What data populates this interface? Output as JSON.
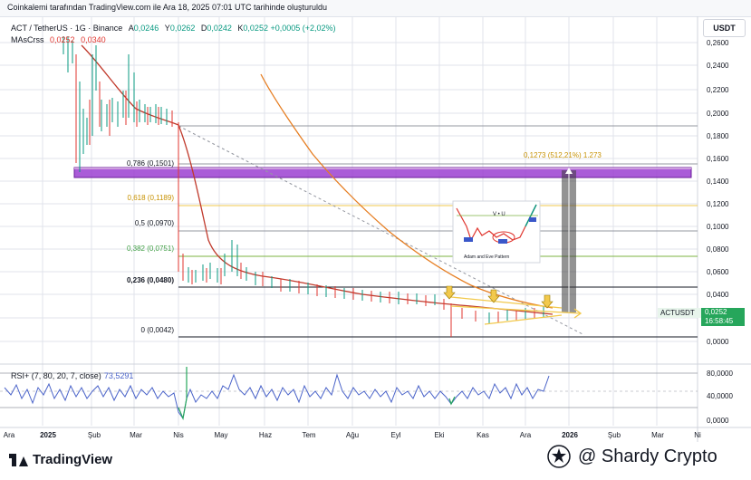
{
  "caption": "Coinkalemi tarafından TradingView.com ile Ara 18, 2025 07:01 UTC tarihinde oluşturuldu",
  "legend": {
    "symbol": "ACT / TetherUS · 1G · Binance",
    "ohlc": [
      {
        "k": "A",
        "v": "0,0246"
      },
      {
        "k": "Y",
        "v": "0,0262"
      },
      {
        "k": "D",
        "v": "0,0242"
      },
      {
        "k": "K",
        "v": "0,0252"
      }
    ],
    "change": "+0,0005 (+2,02%)",
    "mas_label": "MAsCrss",
    "mas_val1": "0,0252",
    "mas_val2": "0,0340"
  },
  "currency_button": "USDT",
  "fib_labels": {
    "f786": "0,786 (0,1501)",
    "f618": "0,618 (0,1189)",
    "f5": "0,5 (0,0970)",
    "f382": "0,382 (0,0751)",
    "f236": "0,236 (0,0480)",
    "f0": "0 (0,0042)"
  },
  "target_label": "0,1273 (512,21%) 1.273",
  "pattern_thumbnail": {
    "center_text": "V • U",
    "caption": "Adam and Eve Pattern"
  },
  "price_axis_labels": [
    "0,2600",
    "0,2400",
    "0,2200",
    "0,2000",
    "0,1800",
    "0,1600",
    "0,1400",
    "0,1200",
    "0,1000",
    "0,0800",
    "0,0600",
    "0,0400",
    "0,0200",
    "0,0000"
  ],
  "price_tag": "ACTUSDT",
  "price_label": {
    "price": "0,0252",
    "countdown": "16:58:45"
  },
  "rsi": {
    "label": "RSI+ (7, 80, 20, 7, close)",
    "value": "73,5291",
    "axis_labels": [
      "80,0000",
      "40,0000",
      "0,0000"
    ]
  },
  "time_axis_labels": [
    "Ara",
    "2025",
    "Şub",
    "Mar",
    "Nis",
    "May",
    "Haz",
    "Tem",
    "Ağu",
    "Eyl",
    "Eki",
    "Kas",
    "Ara",
    "2026",
    "Şub",
    "Mar",
    "Ni"
  ],
  "brand": "TradingView",
  "watermark": "@ Shardy Crypto",
  "colors": {
    "up": "#089981",
    "down": "#e0362f",
    "ma_fast": "#c0392b",
    "ma_slow": "#e67e22",
    "rsi": "#4a63c9",
    "zone": "#9b3fd1"
  },
  "chart_data": {
    "type": "candlestick",
    "symbol": "ACT / TetherUS",
    "timeframe": "1G",
    "y_range": [
      0.0,
      0.27
    ],
    "fib_levels": [
      {
        "ratio": 0.786,
        "price": 0.1501
      },
      {
        "ratio": 0.618,
        "price": 0.1189
      },
      {
        "ratio": 0.5,
        "price": 0.097
      },
      {
        "ratio": 0.382,
        "price": 0.0751
      },
      {
        "ratio": 0.236,
        "price": 0.048
      },
      {
        "ratio": 0,
        "price": 0.0042
      }
    ],
    "target": {
      "price": 0.1273,
      "percent": "512,21%"
    },
    "close_series": [
      {
        "t": "Oca",
        "p": 0.24
      },
      {
        "t": "Oca",
        "p": 0.16
      },
      {
        "t": "Şub",
        "p": 0.2
      },
      {
        "t": "Şub",
        "p": 0.17
      },
      {
        "t": "Mar",
        "p": 0.19
      },
      {
        "t": "Mar",
        "p": 0.19
      },
      {
        "t": "Nis",
        "p": 0.06
      },
      {
        "t": "Nis",
        "p": 0.052
      },
      {
        "t": "May",
        "p": 0.06
      },
      {
        "t": "May",
        "p": 0.05
      },
      {
        "t": "Haz",
        "p": 0.045
      },
      {
        "t": "Tem",
        "p": 0.042
      },
      {
        "t": "Ağu",
        "p": 0.04
      },
      {
        "t": "Eyl",
        "p": 0.038
      },
      {
        "t": "Eki",
        "p": 0.036
      },
      {
        "t": "Eki",
        "p": 0.026
      },
      {
        "t": "Kas",
        "p": 0.024
      },
      {
        "t": "Ara",
        "p": 0.027
      },
      {
        "t": "Ara",
        "p": 0.0252
      }
    ],
    "current_price": 0.0252
  }
}
